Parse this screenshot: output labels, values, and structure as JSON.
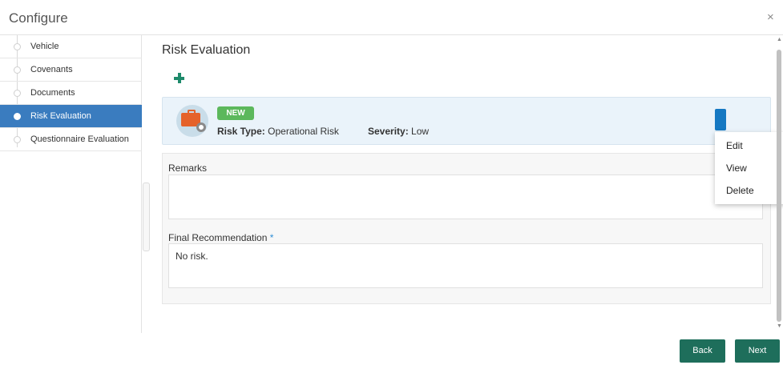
{
  "window": {
    "title": "Configure",
    "close_icon": "×"
  },
  "sidebar": {
    "steps": [
      {
        "label": "Vehicle",
        "active": false
      },
      {
        "label": "Covenants",
        "active": false
      },
      {
        "label": "Documents",
        "active": false
      },
      {
        "label": "Risk Evaluation",
        "active": true
      },
      {
        "label": "Questionnaire Evaluation",
        "active": false
      }
    ]
  },
  "main": {
    "title": "Risk Evaluation",
    "add_icon": "plus-icon",
    "card": {
      "badge": "NEW",
      "risk_type_label": "Risk Type:",
      "risk_type_value": "Operational Risk",
      "severity_label": "Severity:",
      "severity_value": "Low",
      "icon": "briefcase-gear-icon"
    },
    "remarks": {
      "label": "Remarks",
      "value": ""
    },
    "final_recommendation": {
      "label": "Final Recommendation",
      "required_mark": "*",
      "value": "No risk."
    }
  },
  "context_menu": {
    "items": [
      "Edit",
      "View",
      "Delete"
    ]
  },
  "scrollbar": {
    "up_arrow": "▲",
    "down_arrow": "▼"
  },
  "footer": {
    "back_label": "Back",
    "next_label": "Next"
  },
  "colors": {
    "accent": "#3a7cbf",
    "primary_button": "#1e6e5b",
    "badge_new": "#5cb85c",
    "kebab": "#1578c2",
    "card_bg": "#eaf3fa"
  }
}
